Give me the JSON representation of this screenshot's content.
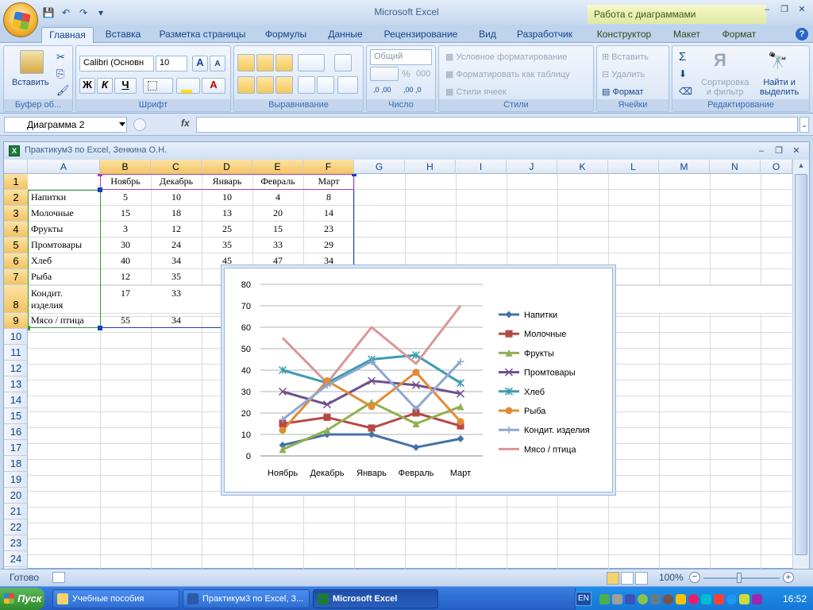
{
  "app": {
    "title": "Microsoft Excel",
    "context_title": "Работа с диаграммами"
  },
  "qat": {
    "save": "💾",
    "undo": "↶",
    "redo": "↷",
    "customize": "▾"
  },
  "window_controls": {
    "minimize": "–",
    "restore": "❐",
    "close": "✕"
  },
  "tabs": [
    "Главная",
    "Вставка",
    "Разметка страницы",
    "Формулы",
    "Данные",
    "Рецензирование",
    "Вид",
    "Разработчик"
  ],
  "context_tabs": [
    "Конструктор",
    "Макет",
    "Формат"
  ],
  "ribbon": {
    "clipboard": {
      "label": "Буфер об...",
      "paste": "Вставить"
    },
    "font": {
      "label": "Шрифт",
      "name": "Calibri (Основн",
      "size": "10",
      "grow": "A",
      "shrink": "A",
      "bold": "Ж",
      "italic": "К",
      "underline": "Ч",
      "font_color": "A"
    },
    "alignment": {
      "label": "Выравнивание"
    },
    "number": {
      "label": "Число",
      "format": "Общий",
      "percent": "%",
      "thousands": "000",
      "inc_dec": ",0 ,00",
      "dec_dec": ",00 ,0"
    },
    "styles": {
      "label": "Стили",
      "conditional": "Условное форматирование",
      "as_table": "Форматировать как таблицу",
      "cell_styles": "Стили ячеек"
    },
    "cells": {
      "label": "Ячейки",
      "insert": "Вставить",
      "delete": "Удалить",
      "format": "Формат"
    },
    "editing": {
      "label": "Редактирование",
      "sum": "Σ",
      "sort1": "Сортировка",
      "sort2": "и фильтр",
      "find1": "Найти и",
      "find2": "выделить"
    }
  },
  "formula_bar": {
    "name_box": "Диаграмма 2",
    "fx": "fx",
    "value": ""
  },
  "workbook": {
    "title": "Практикум3 по Excel, Зенкина О.Н.",
    "icon": "X"
  },
  "columns": [
    "A",
    "B",
    "C",
    "D",
    "E",
    "F",
    "G",
    "H",
    "I",
    "J",
    "K",
    "L",
    "M",
    "N",
    "O"
  ],
  "rows": [
    "1",
    "2",
    "3",
    "4",
    "5",
    "6",
    "7",
    "8",
    "9",
    "10",
    "11",
    "12",
    "13",
    "14",
    "15",
    "16",
    "17",
    "18",
    "19",
    "20",
    "21",
    "22",
    "23",
    "24"
  ],
  "table": {
    "months": [
      "Ноябрь",
      "Декабрь",
      "Январь",
      "Февраль",
      "Март"
    ],
    "rows": [
      {
        "name": "Напитки",
        "values": [
          "5",
          "10",
          "10",
          "4",
          "8"
        ]
      },
      {
        "name": "Молочные",
        "values": [
          "15",
          "18",
          "13",
          "20",
          "14"
        ]
      },
      {
        "name": "Фрукты",
        "values": [
          "3",
          "12",
          "25",
          "15",
          "23"
        ]
      },
      {
        "name": "Промтовары",
        "values": [
          "30",
          "24",
          "35",
          "33",
          "29"
        ]
      },
      {
        "name": "Хлеб",
        "values": [
          "40",
          "34",
          "45",
          "47",
          "34"
        ]
      },
      {
        "name": "Рыба",
        "values": [
          "12",
          "35",
          "",
          "",
          ""
        ]
      },
      {
        "name": "Кондит.",
        "name2": "изделия",
        "values": [
          "17",
          "33",
          "",
          "",
          ""
        ]
      },
      {
        "name": "Мясо / птица",
        "values": [
          "55",
          "34",
          "",
          "",
          ""
        ]
      }
    ]
  },
  "chart_data": {
    "type": "line",
    "categories": [
      "Ноябрь",
      "Декабрь",
      "Январь",
      "Февраль",
      "Март"
    ],
    "ylim": [
      0,
      80
    ],
    "yticks": [
      "0",
      "10",
      "20",
      "30",
      "40",
      "50",
      "60",
      "70",
      "80"
    ],
    "grid": true,
    "legend": "right",
    "series": [
      {
        "name": "Напитки",
        "values": [
          5,
          10,
          10,
          4,
          8
        ],
        "color": "#4472a8",
        "marker": "diamond"
      },
      {
        "name": "Молочные",
        "values": [
          15,
          18,
          13,
          20,
          14
        ],
        "color": "#b54a45",
        "marker": "square"
      },
      {
        "name": "Фрукты",
        "values": [
          3,
          12,
          25,
          15,
          23
        ],
        "color": "#90b050",
        "marker": "triangle"
      },
      {
        "name": "Промтовары",
        "values": [
          30,
          24,
          35,
          33,
          29
        ],
        "color": "#6e4f8e",
        "marker": "x"
      },
      {
        "name": "Хлеб",
        "values": [
          40,
          34,
          45,
          47,
          34
        ],
        "color": "#3d9bb0",
        "marker": "star"
      },
      {
        "name": "Рыба",
        "values": [
          12,
          35,
          23,
          39,
          16
        ],
        "color": "#e38a35",
        "marker": "circle"
      },
      {
        "name": "Кондит. изделия",
        "values": [
          17,
          33,
          44,
          22,
          44
        ],
        "color": "#8ea7d2",
        "marker": "plus"
      },
      {
        "name": "Мясо / птица",
        "values": [
          55,
          34,
          60,
          43,
          70
        ],
        "color": "#d99694",
        "marker": "none"
      }
    ]
  },
  "status": {
    "ready": "Готово",
    "zoom": "100%"
  },
  "taskbar": {
    "start": "Пуск",
    "tasks": [
      "Учебные пособия",
      "Практикум3 по Excel, З...",
      "Microsoft Excel"
    ],
    "lang": "EN",
    "clock": "16:52"
  }
}
